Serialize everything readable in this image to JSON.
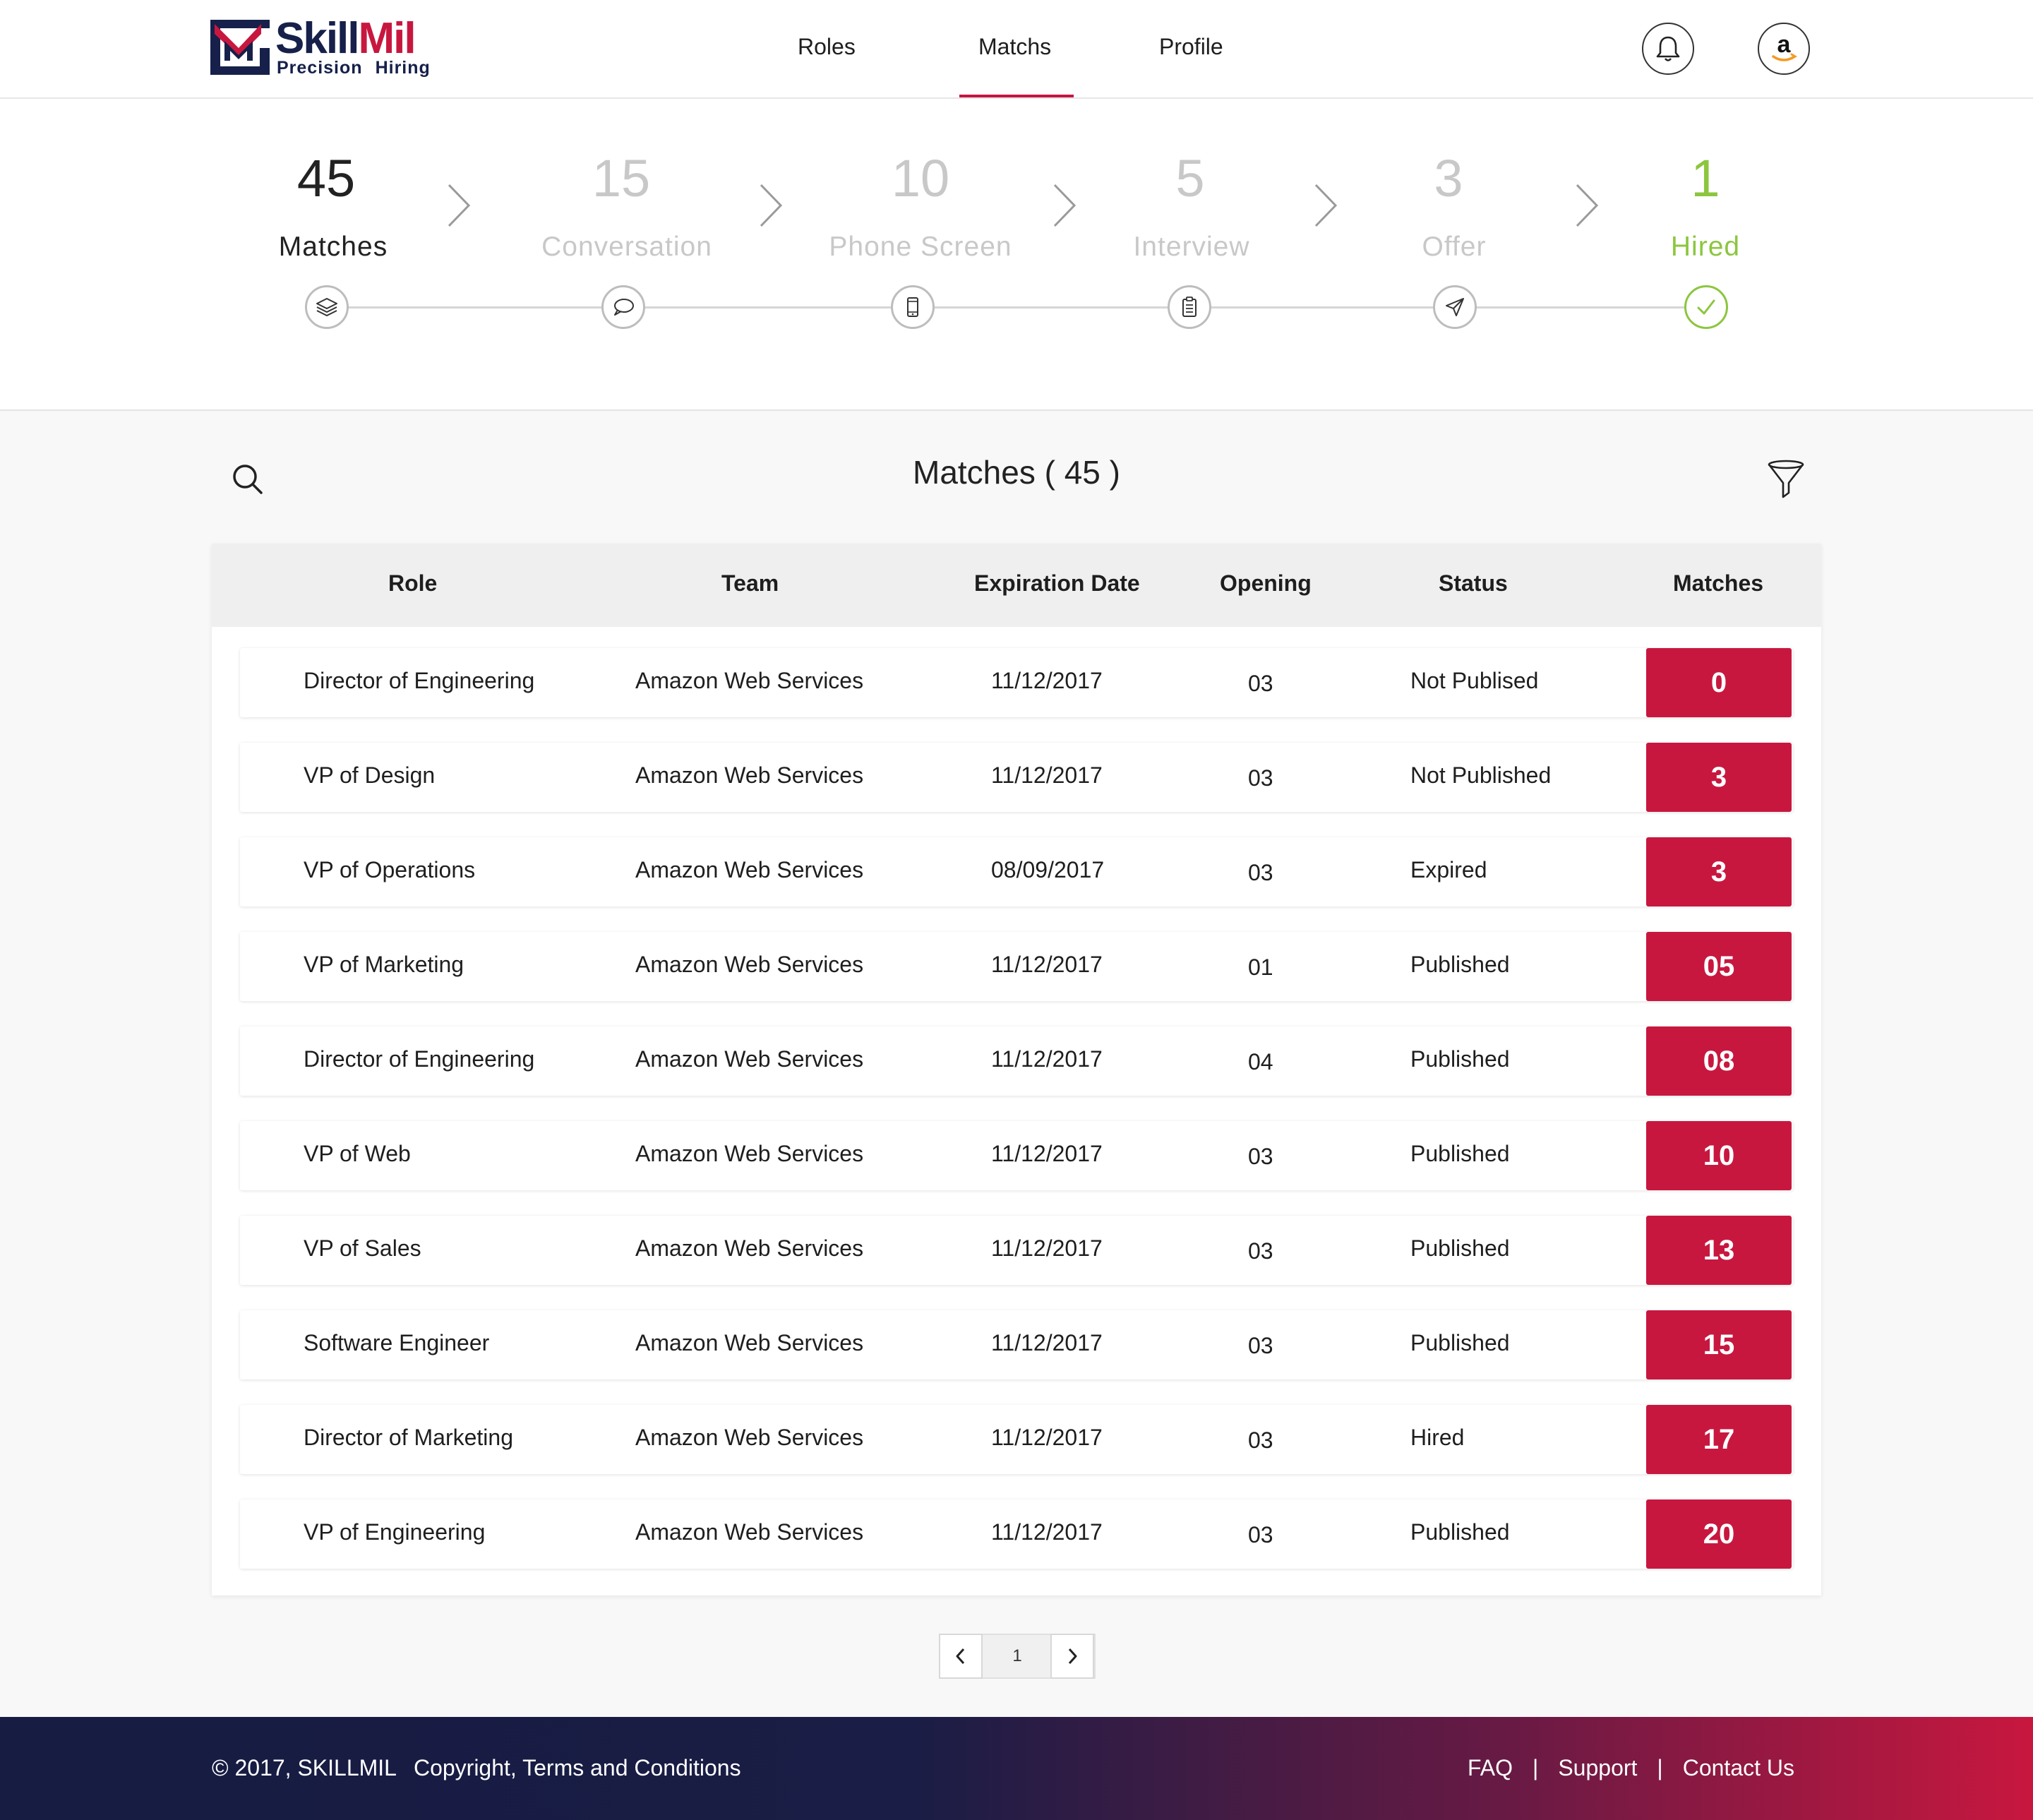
{
  "brand": {
    "name_part1": "Skill",
    "name_part2": "Mil",
    "tagline_1": "Precision",
    "tagline_2": "Hiring",
    "primary_color": "#c8173f",
    "navy_color": "#16204a",
    "success_color": "#8cc63f"
  },
  "nav": {
    "items": [
      "Roles",
      "Matchs",
      "Profile"
    ],
    "active": "Matchs",
    "notification_icon": "bell-icon",
    "avatar_icon": "amazon-logo-icon"
  },
  "pipeline": [
    {
      "count": "45",
      "label": "Matches",
      "icon": "layers-icon",
      "state": "active"
    },
    {
      "count": "15",
      "label": "Conversation",
      "icon": "chat-bubble-icon",
      "state": "inactive"
    },
    {
      "count": "10",
      "label": "Phone Screen",
      "icon": "phone-icon",
      "state": "inactive"
    },
    {
      "count": "5",
      "label": "Interview",
      "icon": "clipboard-icon",
      "state": "inactive"
    },
    {
      "count": "3",
      "label": "Offer",
      "icon": "paper-plane-icon",
      "state": "inactive"
    },
    {
      "count": "1",
      "label": "Hired",
      "icon": "check-circle-icon",
      "state": "done"
    }
  ],
  "matches": {
    "title": "Matches ( 45 )",
    "search_icon": "search-icon",
    "filter_icon": "filter-icon",
    "columns": [
      "Role",
      "Team",
      "Expiration Date",
      "Opening",
      "Status",
      "Matches"
    ],
    "rows": [
      {
        "role": "Director of Engineering",
        "team": "Amazon Web Services",
        "expiration": "11/12/2017",
        "opening": "03",
        "status": "Not Publised",
        "matches": "0"
      },
      {
        "role": "VP of Design",
        "team": "Amazon Web Services",
        "expiration": "11/12/2017",
        "opening": "03",
        "status": "Not Published",
        "matches": "3"
      },
      {
        "role": "VP of Operations",
        "team": "Amazon Web Services",
        "expiration": "08/09/2017",
        "opening": "03",
        "status": "Expired",
        "matches": "3"
      },
      {
        "role": "VP of Marketing",
        "team": "Amazon Web Services",
        "expiration": "11/12/2017",
        "opening": "01",
        "status": "Published",
        "matches": "05"
      },
      {
        "role": "Director of Engineering",
        "team": "Amazon Web Services",
        "expiration": "11/12/2017",
        "opening": "04",
        "status": "Published",
        "matches": "08"
      },
      {
        "role": "VP of Web",
        "team": "Amazon Web Services",
        "expiration": "11/12/2017",
        "opening": "03",
        "status": "Published",
        "matches": "10"
      },
      {
        "role": "VP of Sales",
        "team": "Amazon Web Services",
        "expiration": "11/12/2017",
        "opening": "03",
        "status": "Published",
        "matches": "13"
      },
      {
        "role": "Software Engineer",
        "team": "Amazon Web Services",
        "expiration": "11/12/2017",
        "opening": "03",
        "status": "Published",
        "matches": "15"
      },
      {
        "role": "Director of Marketing",
        "team": "Amazon Web Services",
        "expiration": "11/12/2017",
        "opening": "03",
        "status": "Hired",
        "matches": "17"
      },
      {
        "role": "VP of Engineering",
        "team": "Amazon Web Services",
        "expiration": "11/12/2017",
        "opening": "03",
        "status": "Published",
        "matches": "20"
      }
    ]
  },
  "pagination": {
    "current_page": "1",
    "prev_icon": "chevron-left-icon",
    "next_icon": "chevron-right-icon"
  },
  "footer": {
    "copyright": "© 2017, SKILLMIL",
    "terms": "Copyright, Terms and Conditions",
    "links": [
      "FAQ",
      "Support",
      "Contact Us"
    ],
    "separator": "|"
  }
}
